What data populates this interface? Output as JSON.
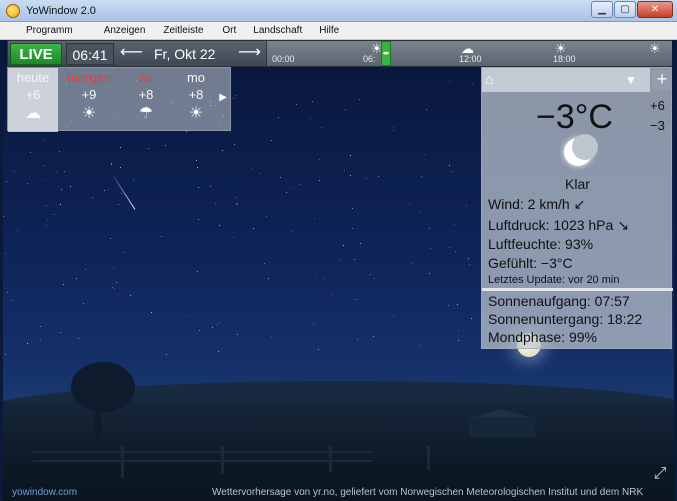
{
  "window": {
    "title": "YoWindow 2.0"
  },
  "menu": [
    "Programm",
    "Anzeigen",
    "Zeitleiste",
    "Ort",
    "Landschaft",
    "Hilfe"
  ],
  "timebar": {
    "live_label": "LIVE",
    "time": "06:41",
    "date": "Fr, Okt 22",
    "timeline_labels": [
      "00:00",
      "06:",
      "12:00",
      "18:00"
    ],
    "timeline_icons": [
      "sun-cloud-icon",
      "cloud-icon",
      "sun-cloud-icon",
      "sun-icon"
    ]
  },
  "forecast": {
    "days": [
      {
        "name": "heute",
        "temp": "+6",
        "icon": "cloud-icon",
        "highlight": false
      },
      {
        "name": "morgen",
        "temp": "+9",
        "icon": "sun-cloud-icon",
        "highlight": true
      },
      {
        "name": "so",
        "temp": "+8",
        "icon": "rain-cloud-icon",
        "highlight": true
      },
      {
        "name": "mo",
        "temp": "+8",
        "icon": "sun-icon",
        "highlight": false
      }
    ]
  },
  "info": {
    "temperature": "−3°C",
    "high": "+6",
    "low": "−3",
    "condition": "Klar",
    "wind": "Wind:  2 km/h ↙",
    "pressure": "Luftdruck:  1023 hPa ↘",
    "humidity": "Luftfeuchte:  93%",
    "feels": "Gefühlt:  −3°C",
    "updated": "Letztes Update:  vor 20 min",
    "sunrise": "Sonnenaufgang:  07:57",
    "sunset": "Sonnenuntergang:  18:22",
    "moonphase": "Mondphase:  99%"
  },
  "footer": {
    "site": "yowindow.com",
    "credit": "Wettervorhersage von yr.no, geliefert vom Norwegischen Meteorologischen Institut und dem NRK"
  }
}
